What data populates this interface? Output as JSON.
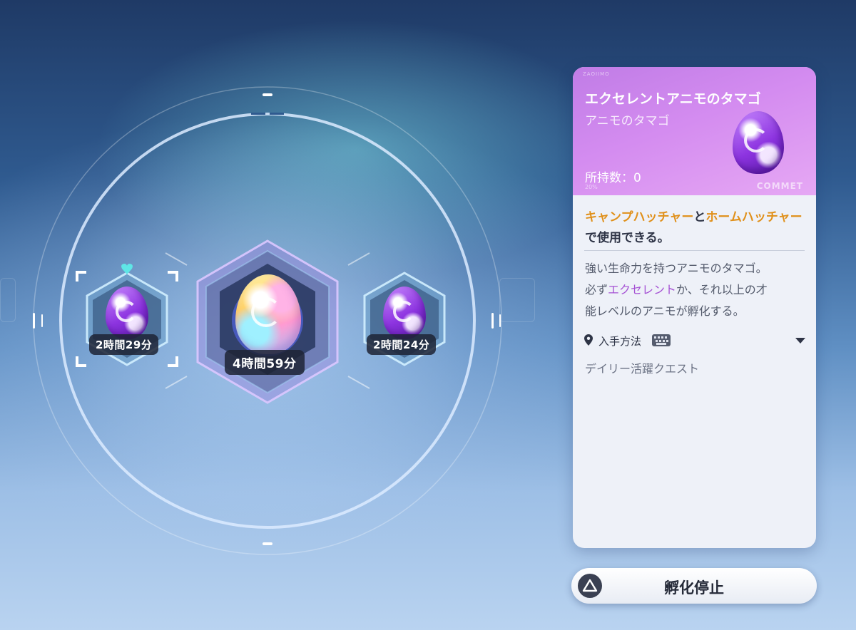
{
  "incubator": {
    "slots": [
      {
        "timer": "2時間29分",
        "egg": "purple",
        "selected": true
      },
      {
        "timer": "4時間59分",
        "egg": "rainbow",
        "selected": false
      },
      {
        "timer": "2時間24分",
        "egg": "purple",
        "selected": false
      }
    ]
  },
  "detail": {
    "brand_small": "ZAOIIMO",
    "title": "エクセレントアニモのタマゴ",
    "subtitle": "アニモのタマゴ",
    "owned_label": "所持数：0",
    "brand_logo": "COMMET",
    "tag": "20%",
    "usage": {
      "part1": "キャンプハッチャー",
      "part2": "と",
      "part3": "ホームハッチャー",
      "part4": "で使用できる。"
    },
    "desc": {
      "line1": "強い生命力を持つアニモのタマゴ。",
      "line2a": "必ず",
      "line2b": "エクセレント",
      "line2c": "か、それ以上の才",
      "line3": "能レベルのアニモが孵化する。"
    },
    "acquire_label": "入手方法",
    "source": "デイリー活躍クエスト"
  },
  "action": {
    "stop_label": "孵化停止",
    "button_glyph": "triangle-icon"
  },
  "colors": {
    "accent_purple": "#a551d4",
    "accent_orange": "#e0901a",
    "panel_head": "#d48cf0"
  }
}
